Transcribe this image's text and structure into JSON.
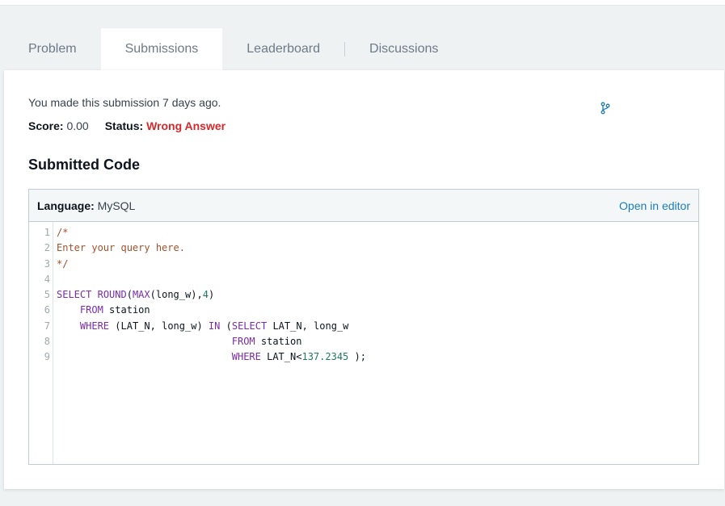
{
  "tabs": [
    {
      "label": "Problem",
      "active": false
    },
    {
      "label": "Submissions",
      "active": true
    },
    {
      "label": "Leaderboard",
      "active": false
    },
    {
      "label": "Discussions",
      "active": false
    }
  ],
  "submission": {
    "made_text": "You made this submission 7 days ago.",
    "score_label": "Score:",
    "score_value": "0.00",
    "status_label": "Status:",
    "status_value": "Wrong Answer"
  },
  "section_title": "Submitted Code",
  "code": {
    "language_label": "Language:",
    "language_value": "MySQL",
    "open_editor": "Open in editor",
    "line_numbers": [
      "1",
      "2",
      "3",
      "4",
      "5",
      "6",
      "7",
      "8",
      "9"
    ],
    "lines": [
      "/*",
      "Enter your query here.",
      "*/",
      "",
      "SELECT ROUND(MAX(long_w),4)",
      "    FROM station",
      "    WHERE (LAT_N, long_w) IN (SELECT LAT_N, long_w",
      "                              FROM station",
      "                              WHERE LAT_N<137.2345 );"
    ]
  },
  "colors": {
    "status_wrong": "#d6292c",
    "link": "#1c7cb8",
    "comment": "#a0522d",
    "keyword": "#7a2ca8",
    "number": "#1f7a5a"
  },
  "icons": {
    "branch": "code-branch-icon"
  }
}
